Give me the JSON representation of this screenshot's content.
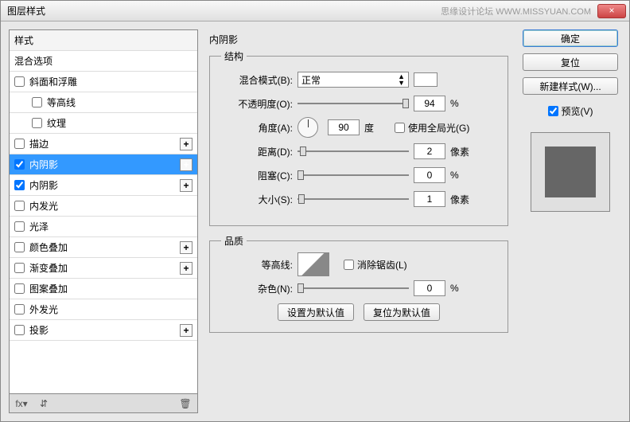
{
  "title": "图层样式",
  "watermark": "思缘设计论坛  WWW.MISSYUAN.COM",
  "close": "×",
  "styleList": {
    "header": "样式",
    "blendOptions": "混合选项",
    "items": [
      {
        "label": "斜面和浮雕",
        "checked": false,
        "plus": false
      },
      {
        "label": "等高线",
        "checked": false,
        "plus": false,
        "indent": true
      },
      {
        "label": "纹理",
        "checked": false,
        "plus": false,
        "indent": true
      },
      {
        "label": "描边",
        "checked": false,
        "plus": true
      },
      {
        "label": "内阴影",
        "checked": true,
        "plus": true,
        "selected": true
      },
      {
        "label": "内阴影",
        "checked": true,
        "plus": true
      },
      {
        "label": "内发光",
        "checked": false,
        "plus": false
      },
      {
        "label": "光泽",
        "checked": false,
        "plus": false
      },
      {
        "label": "颜色叠加",
        "checked": false,
        "plus": true
      },
      {
        "label": "渐变叠加",
        "checked": false,
        "plus": true
      },
      {
        "label": "图案叠加",
        "checked": false,
        "plus": false
      },
      {
        "label": "外发光",
        "checked": false,
        "plus": false
      },
      {
        "label": "投影",
        "checked": false,
        "plus": true
      }
    ]
  },
  "panel": {
    "title": "内阴影",
    "structureLegend": "结构",
    "blendMode": {
      "label": "混合模式(B):",
      "value": "正常"
    },
    "opacity": {
      "label": "不透明度(O):",
      "value": "94",
      "unit": "%"
    },
    "angle": {
      "label": "角度(A):",
      "value": "90",
      "unit": "度"
    },
    "globalLight": {
      "label": "使用全局光(G)",
      "checked": false
    },
    "distance": {
      "label": "距离(D):",
      "value": "2",
      "unit": "像素"
    },
    "choke": {
      "label": "阻塞(C):",
      "value": "0",
      "unit": "%"
    },
    "size": {
      "label": "大小(S):",
      "value": "1",
      "unit": "像素"
    },
    "qualityLegend": "品质",
    "contourLabel": "等高线:",
    "antialias": {
      "label": "消除锯齿(L)",
      "checked": false
    },
    "noise": {
      "label": "杂色(N):",
      "value": "0",
      "unit": "%"
    },
    "defaultBtn": "设置为默认值",
    "resetBtn": "复位为默认值"
  },
  "right": {
    "ok": "确定",
    "cancel": "复位",
    "newStyle": "新建样式(W)...",
    "preview": "预览(V)"
  },
  "footer": {
    "fx": "fx"
  }
}
